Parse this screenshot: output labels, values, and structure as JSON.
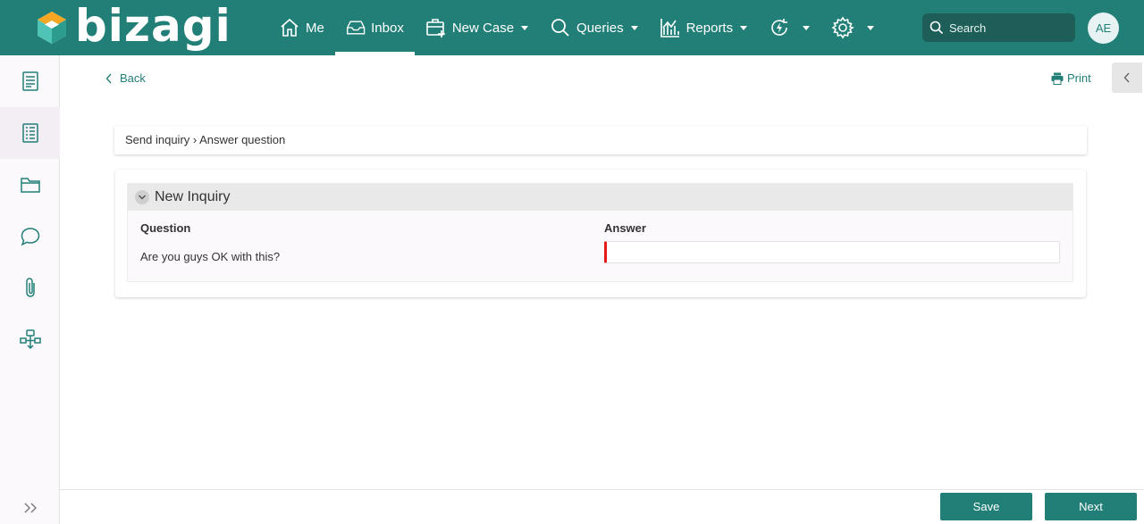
{
  "brand": {
    "name": "bizagi",
    "color": "#217f77"
  },
  "nav": {
    "items": [
      {
        "label": "Me",
        "icon": "home-icon"
      },
      {
        "label": "Inbox",
        "icon": "inbox-icon",
        "active": true
      },
      {
        "label": "New Case",
        "icon": "new-case-icon",
        "dropdown": true
      },
      {
        "label": "Queries",
        "icon": "search-icon",
        "dropdown": true
      },
      {
        "label": "Reports",
        "icon": "reports-icon",
        "dropdown": true
      },
      {
        "label": "",
        "icon": "bolt-refresh-icon",
        "dropdown": true
      },
      {
        "label": "",
        "icon": "gear-icon",
        "dropdown": true
      }
    ],
    "search_placeholder": "Search",
    "avatar_initials": "AE"
  },
  "sidebar": {
    "items": [
      {
        "icon": "form-icon"
      },
      {
        "icon": "document-list-icon",
        "active": true
      },
      {
        "icon": "folder-icon"
      },
      {
        "icon": "chat-icon"
      },
      {
        "icon": "paperclip-icon"
      },
      {
        "icon": "workflow-icon"
      }
    ],
    "expand_icon": "double-chevron-right-icon"
  },
  "toolbar": {
    "back_label": "Back",
    "print_label": "Print"
  },
  "breadcrumb": {
    "text": "Send inquiry › Answer question"
  },
  "form": {
    "group_title": "New Inquiry",
    "question_header": "Question",
    "answer_header": "Answer",
    "question_text": "Are you guys OK with this?",
    "answer_value": "",
    "required_color": "#e51a1a"
  },
  "footer": {
    "save_label": "Save",
    "next_label": "Next"
  }
}
